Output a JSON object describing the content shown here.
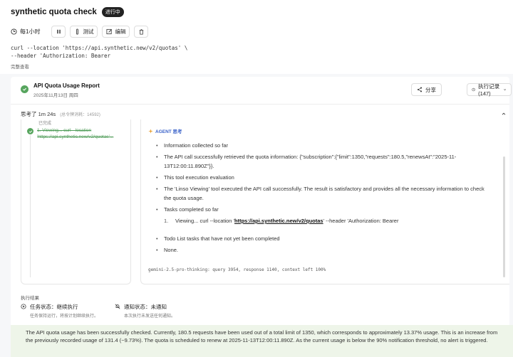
{
  "header": {
    "title": "synthetic quota check",
    "badge": "进行中"
  },
  "toolbar": {
    "schedule": "每1小时",
    "test_label": "测试",
    "edit_label": "编辑"
  },
  "command": {
    "line1": "curl --location 'https://api.synthetic.new/v2/quotas' \\",
    "line2": "--header 'Authorization: Bearer",
    "view_all": "完整查看"
  },
  "report": {
    "title": "API Quota Usage Report",
    "date": "2025年11月13日 周四",
    "share_label": "分享",
    "history_label": "执行记录(147)"
  },
  "thinking": {
    "label": "思考了 1m 24s",
    "sub": "(总令牌消耗：14592)",
    "left_top": "已完成",
    "step_text": "1. Viewing... curl --location 'https://api.synthetic.new/v2/quotas'...",
    "agent_label": "AGENT 思考",
    "bullets": [
      "Information collected so far",
      "The API call successfully retrieved the quota information: {\"subscription\":{\"limit\":1350,\"requests\":180.5,\"renewsAt\":\"2025-11-13T12:00:11.890Z\"}}.",
      "This tool execution evaluation",
      "The 'Linso Viewing' tool executed the API call successfully. The result is satisfactory and provides all the necessary information to check the quota usage.",
      "Tasks completed so far"
    ],
    "numbered": {
      "prefix": "Viewing... curl --location '",
      "link": "https://api.synthetic.new/v2/quotas",
      "suffix": "' --header 'Authorization: Bearer"
    },
    "bullets_after": [
      "Todo List tasks that have not yet been completed",
      "None."
    ],
    "model_line": "gemini-2.5-pro-thinking: query 3954, response 1140, context left 100%"
  },
  "execution": {
    "label": "执行结果",
    "task_status_title": "任务状态：继续执行",
    "task_status_sub": "任务保持运行，将按计划继续执行。",
    "notify_status_title": "通知状态：未通知",
    "notify_status_sub": "本次执行未发送任何通知。"
  },
  "summary": {
    "text": "The API quota usage has been successfully checked. Currently, 180.5 requests have been used out of a total limit of 1350, which corresponds to approximately 13.37% usage. This is an increase from the previously recorded usage of 131.4 (~9.73%). The quota is scheduled to renew at 2025-11-13T12:00:11.890Z. As the current usage is below the 90% notification threshold, no alert is triggered."
  },
  "colors": {
    "success": "#57a55e",
    "agent": "#3a62c9",
    "summary_bg": "#eef5e9"
  }
}
